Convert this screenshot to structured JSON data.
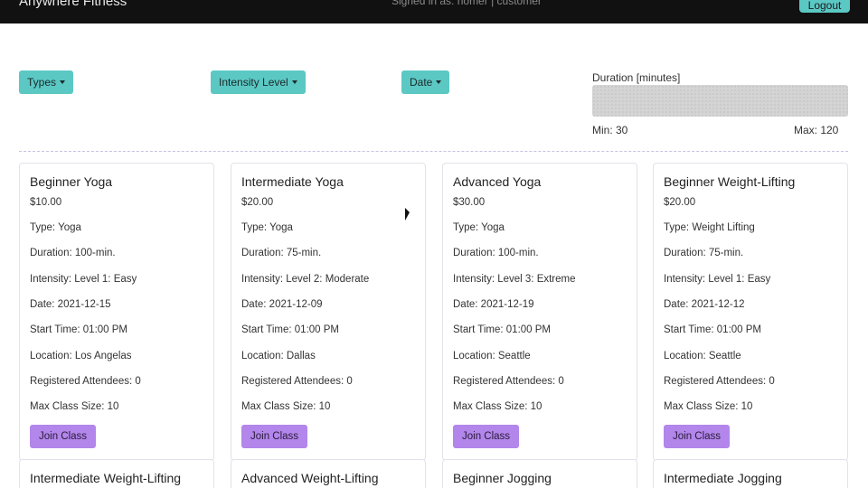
{
  "navbar": {
    "brand": "Anywhere Fitness",
    "signed_in": "Signed in as: homer | customer",
    "logout_label": "Logout"
  },
  "filters": {
    "types_label": "Types",
    "intensity_label": "Intensity Level",
    "date_label": "Date",
    "duration_label": "Duration [minutes]",
    "duration_min": "Min: 30",
    "duration_max": "Max: 120"
  },
  "classes": [
    {
      "name": "Beginner Yoga",
      "price": "$10.00",
      "type": "Type: Yoga",
      "duration": "Duration: 100-min.",
      "intensity": "Intensity: Level 1: Easy",
      "date": "Date: 2021-12-15",
      "start_time": "Start Time: 01:00 PM",
      "location": "Location: Los Angelas",
      "attendees": "Registered Attendees: 0",
      "max_size": "Max Class Size: 10",
      "join_label": "Join Class"
    },
    {
      "name": "Intermediate Yoga",
      "price": "$20.00",
      "type": "Type: Yoga",
      "duration": "Duration: 75-min.",
      "intensity": "Intensity: Level 2: Moderate",
      "date": "Date: 2021-12-09",
      "start_time": "Start Time: 01:00 PM",
      "location": "Location: Dallas",
      "attendees": "Registered Attendees: 0",
      "max_size": "Max Class Size: 10",
      "join_label": "Join Class"
    },
    {
      "name": "Advanced Yoga",
      "price": "$30.00",
      "type": "Type: Yoga",
      "duration": "Duration: 100-min.",
      "intensity": "Intensity: Level 3: Extreme",
      "date": "Date: 2021-12-19",
      "start_time": "Start Time: 01:00 PM",
      "location": "Location: Seattle",
      "attendees": "Registered Attendees: 0",
      "max_size": "Max Class Size: 10",
      "join_label": "Join Class"
    },
    {
      "name": "Beginner Weight-Lifting",
      "price": "$20.00",
      "type": "Type: Weight Lifting",
      "duration": "Duration: 75-min.",
      "intensity": "Intensity: Level 1: Easy",
      "date": "Date: 2021-12-12",
      "start_time": "Start Time: 01:00 PM",
      "location": "Location: Seattle",
      "attendees": "Registered Attendees: 0",
      "max_size": "Max Class Size: 10",
      "join_label": "Join Class"
    }
  ],
  "more_classes": [
    "Intermediate Weight-Lifting",
    "Advanced Weight-Lifting",
    "Beginner Jogging",
    "Intermediate Jogging"
  ],
  "colors": {
    "navbar": "#111111",
    "filter_button": "#5bc8c4",
    "join_button": "#b286ea"
  }
}
